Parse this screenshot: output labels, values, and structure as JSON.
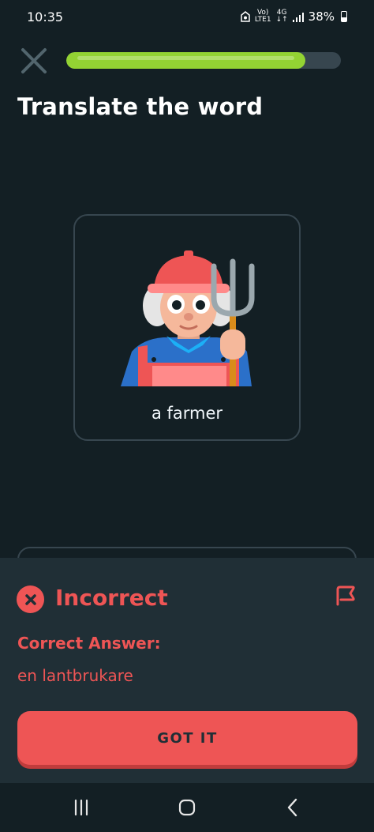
{
  "status_bar": {
    "time": "10:35",
    "network_top": "Vo)",
    "network_bottom": "LTE1",
    "generation": "4G",
    "battery": "38%"
  },
  "lesson": {
    "progress": 0.87,
    "title": "Translate the word"
  },
  "card": {
    "image": "farmer-illustration",
    "word": "a farmer"
  },
  "feedback": {
    "status": "Incorrect",
    "correct_answer_label": "Correct Answer:",
    "correct_answer": "en lantbrukare",
    "button_label": "GOT IT"
  },
  "icons": {
    "close": "close-icon",
    "report": "flag-icon",
    "incorrect": "x-circle-icon",
    "nav": [
      "recent-apps-icon",
      "home-icon",
      "back-icon"
    ]
  },
  "colors": {
    "background": "#131f24",
    "sheet": "#202f36",
    "progress": "#93d333",
    "error": "#ee5555",
    "border": "#37464f"
  }
}
